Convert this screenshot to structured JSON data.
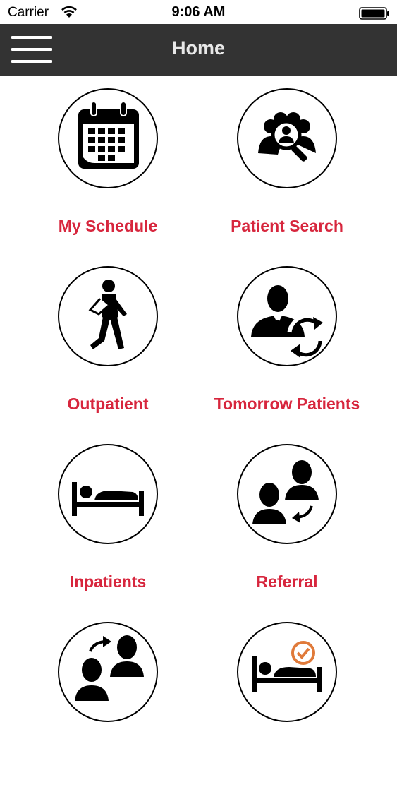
{
  "status_bar": {
    "carrier": "Carrier",
    "time": "9:06 AM",
    "icons": [
      "wifi-icon",
      "battery-icon"
    ]
  },
  "nav": {
    "title": "Home",
    "menu_icon": "hamburger-menu-icon"
  },
  "colors": {
    "nav_background": "#333333",
    "label_red": "#d7263d",
    "accent_orange": "#e07a3a"
  },
  "tiles": [
    {
      "label": "My Schedule",
      "icon": "calendar-icon"
    },
    {
      "label": "Patient Search",
      "icon": "patient-search-icon"
    },
    {
      "label": "Outpatient",
      "icon": "walking-patient-icon"
    },
    {
      "label": "Tomorrow Patients",
      "icon": "doctor-refresh-icon"
    },
    {
      "label": "Inpatients",
      "icon": "bed-icon"
    },
    {
      "label": "Referral",
      "icon": "referral-icon"
    },
    {
      "label": "",
      "icon": "transfer-icon"
    },
    {
      "label": "",
      "icon": "discharge-bed-icon"
    }
  ]
}
